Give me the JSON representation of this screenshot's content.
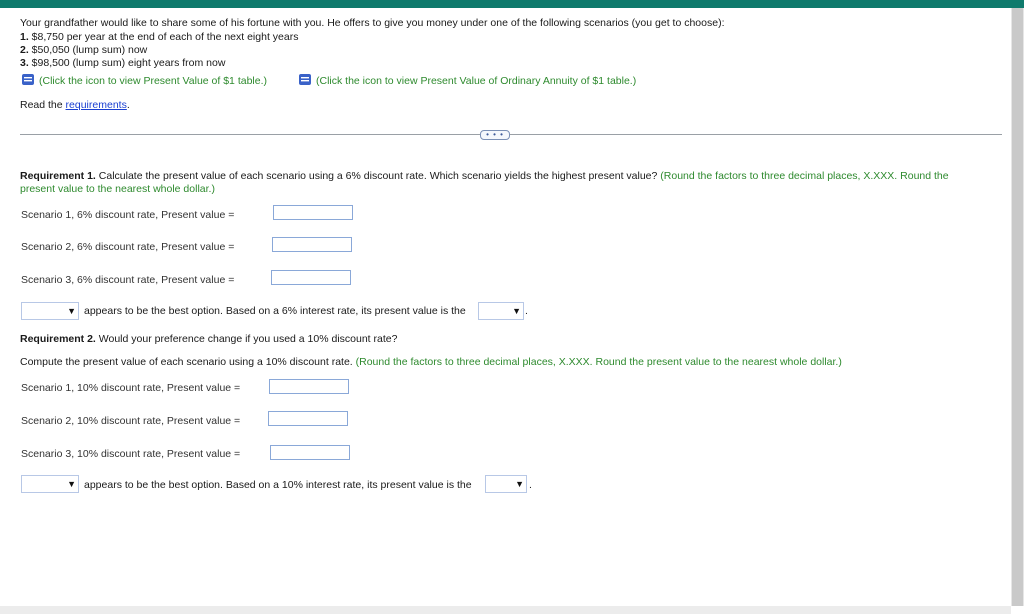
{
  "problem": {
    "intro": "Your grandfather would like to share some of his fortune with you. He offers to give you money under one of the following scenarios (you get to choose):",
    "scenarios": [
      {
        "num": "1.",
        "text": " $8,750 per year at the end of each of the next eight years"
      },
      {
        "num": "2.",
        "text": " $50,050 (lump sum) now"
      },
      {
        "num": "3.",
        "text": " $98,500 (lump sum) eight years from now"
      }
    ],
    "table_link_1": "(Click the icon to view Present Value of $1 table.)",
    "table_link_2": "(Click the icon to view Present Value of Ordinary Annuity of $1 table.)",
    "read_prefix": "Read the ",
    "requirements_link": "requirements",
    "read_suffix": "."
  },
  "more_button": "• • •",
  "req1": {
    "title": "Requirement 1.",
    "text": " Calculate the present value of each scenario using a 6% discount rate. Which scenario yields the highest present value?",
    "hint_line1": " (Round the factors to three decimal places, X.XXX. Round the",
    "hint_line2": "present value to the nearest whole dollar.)",
    "rows": [
      {
        "label": "Scenario 1, 6% discount rate, Present value =",
        "value": ""
      },
      {
        "label": "Scenario 2, 6% discount rate, Present value =",
        "value": ""
      },
      {
        "label": "Scenario 3, 6% discount rate, Present value =",
        "value": ""
      }
    ],
    "best_text": "appears to be the best option. Based on a 6% interest rate, its present value is the",
    "dropdown_1_value": "",
    "dropdown_2_value": ""
  },
  "req2": {
    "title": "Requirement 2.",
    "text": " Would your preference change if you used a 10% discount rate?",
    "compute_text": "Compute the present value of each scenario using a 10% discount rate.",
    "hint": " (Round the factors to three decimal places, X.XXX. Round the present value to the nearest whole dollar.)",
    "rows": [
      {
        "label": "Scenario 1, 10% discount rate, Present value =",
        "value": ""
      },
      {
        "label": "Scenario 2, 10% discount rate, Present value =",
        "value": ""
      },
      {
        "label": "Scenario 3, 10% discount rate, Present value =",
        "value": ""
      }
    ],
    "best_text": "appears to be the best option. Based on a 10% interest rate, its present value is the",
    "dropdown_1_value": "",
    "dropdown_2_value": ""
  },
  "icons": {
    "document": "document-icon",
    "dropdown_arrow": "▼"
  },
  "colors": {
    "topbar": "#0e7a6c",
    "hint_green": "#2e8a2e",
    "link_blue": "#1a3fd1"
  }
}
